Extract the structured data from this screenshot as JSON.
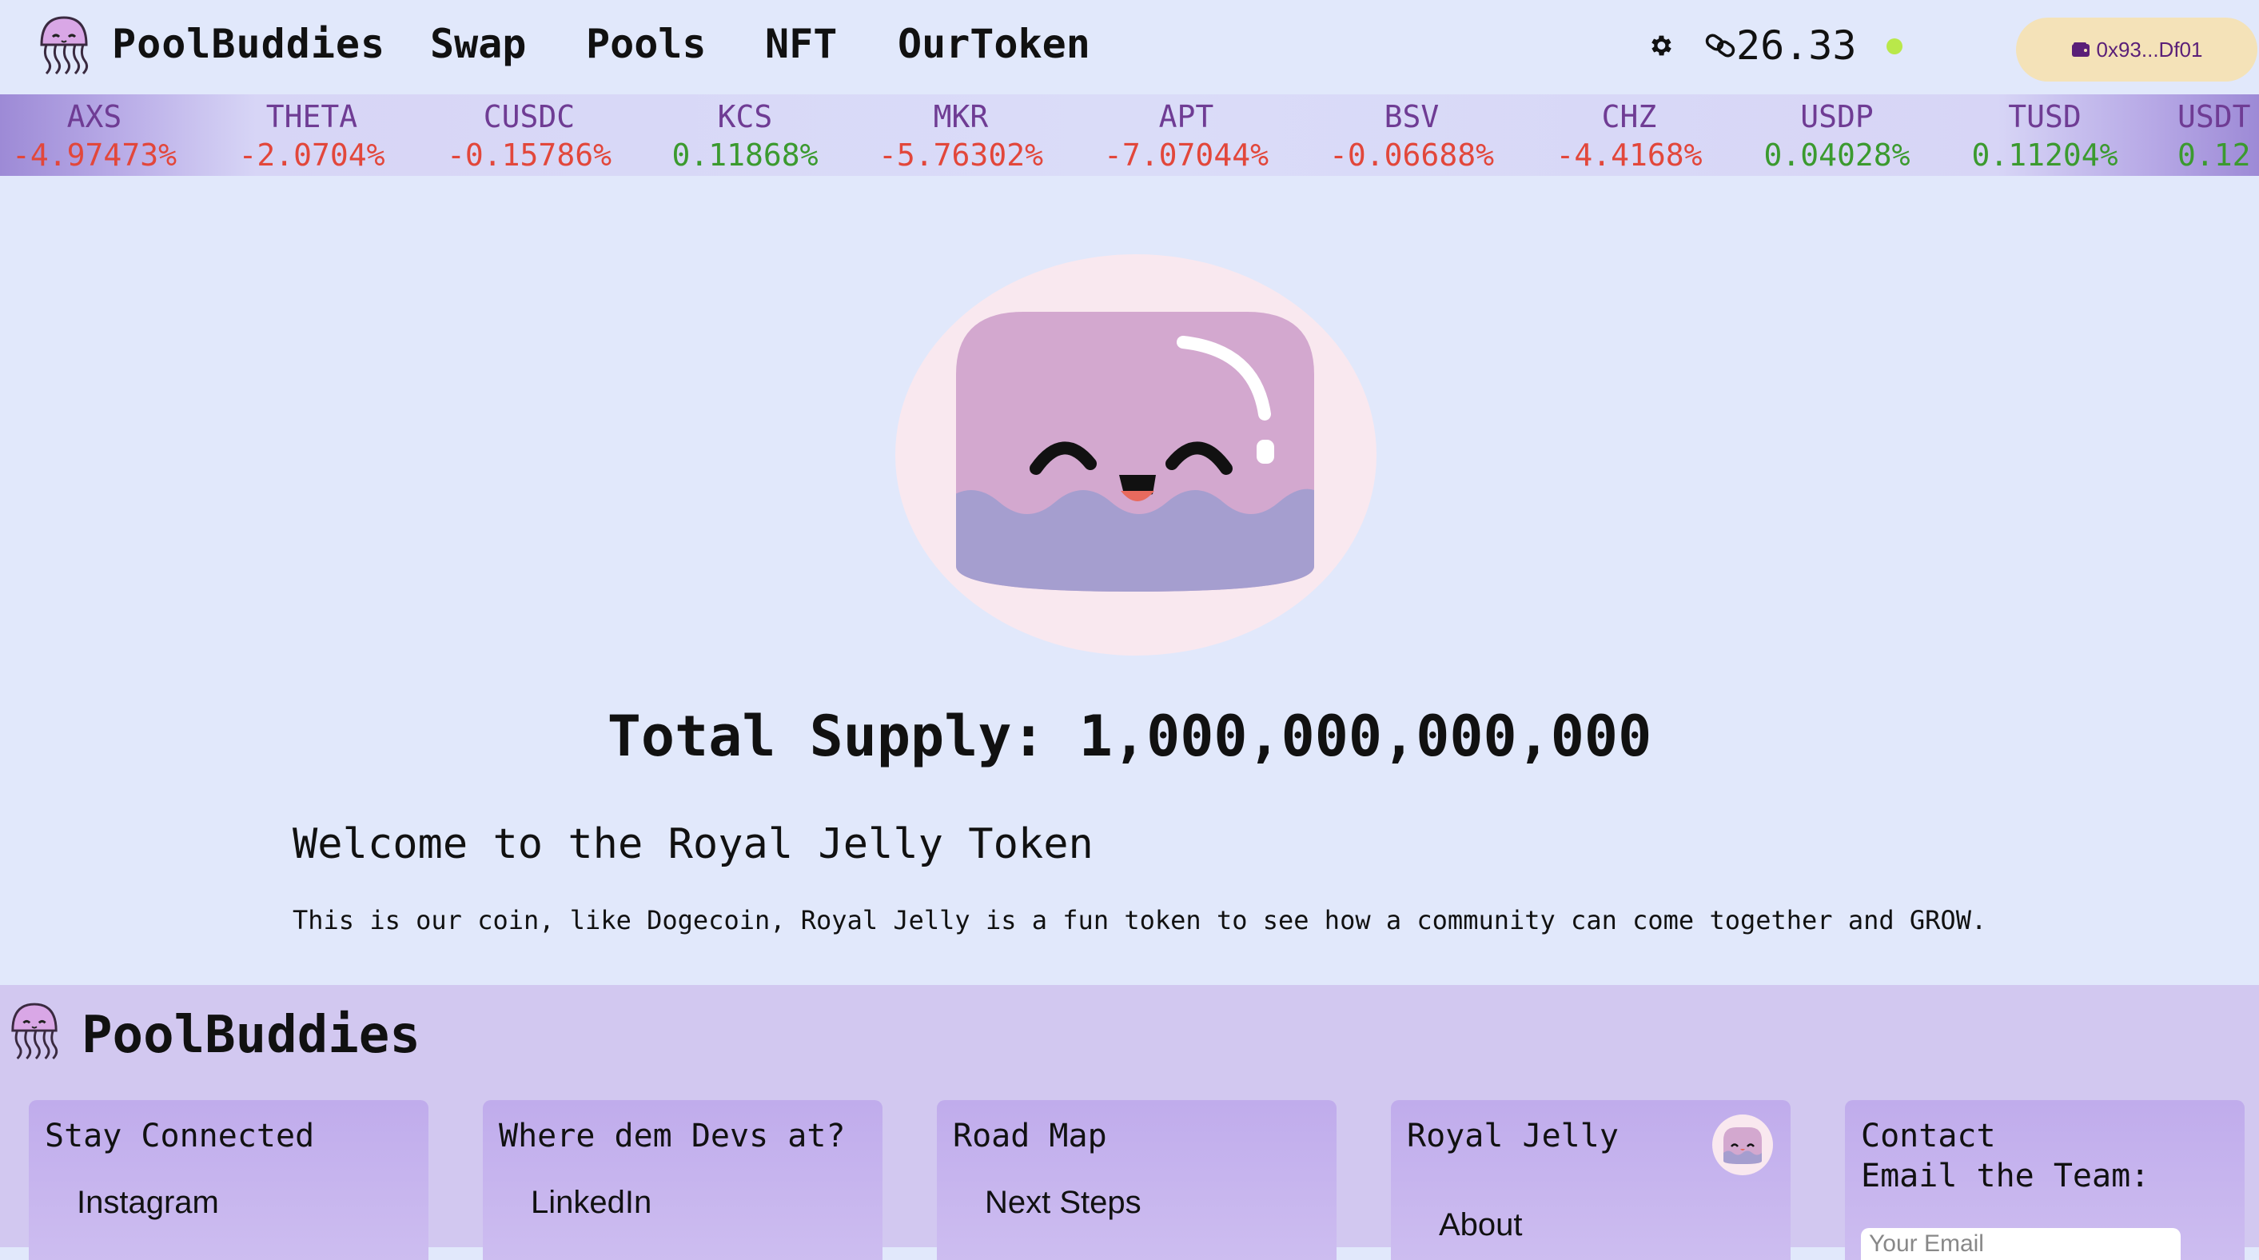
{
  "nav": {
    "brand": "PoolBuddies",
    "links": [
      "Swap",
      "Pools",
      "NFT",
      "OurToken"
    ],
    "price": "26.33",
    "wallet": "0x93...Df01"
  },
  "ticker": [
    {
      "symbol": "AXS",
      "change": "-4.97473%",
      "direction": "neg"
    },
    {
      "symbol": "THETA",
      "change": "-2.0704%",
      "direction": "neg"
    },
    {
      "symbol": "CUSDC",
      "change": "-0.15786%",
      "direction": "neg"
    },
    {
      "symbol": "KCS",
      "change": "0.11868%",
      "direction": "pos"
    },
    {
      "symbol": "MKR",
      "change": "-5.76302%",
      "direction": "neg"
    },
    {
      "symbol": "APT",
      "change": "-7.07044%",
      "direction": "neg"
    },
    {
      "symbol": "BSV",
      "change": "-0.06688%",
      "direction": "neg"
    },
    {
      "symbol": "CHZ",
      "change": "-4.4168%",
      "direction": "neg"
    },
    {
      "symbol": "USDP",
      "change": "0.04028%",
      "direction": "pos"
    },
    {
      "symbol": "TUSD",
      "change": "0.11204%",
      "direction": "pos"
    },
    {
      "symbol": "USDT",
      "change": "0.12",
      "direction": "pos"
    }
  ],
  "hero": {
    "supply": "Total Supply: 1,000,000,000,000",
    "welcome": "Welcome to the Royal Jelly Token",
    "description": "This is our coin, like Dogecoin, Royal Jelly is a fun token to see how a community can come together and GROW."
  },
  "footer": {
    "brand": "PoolBuddies",
    "cards": [
      {
        "title": "Stay Connected",
        "link": "Instagram"
      },
      {
        "title": "Where dem Devs at?",
        "link": "LinkedIn"
      },
      {
        "title": "Road Map",
        "link": "Next Steps"
      },
      {
        "title": "Royal Jelly",
        "link": "About"
      },
      {
        "title": "Contact\nEmail the Team:",
        "placeholder": "Your Email"
      }
    ]
  },
  "colors": {
    "background": "#e1e8fb",
    "negative": "#e2473b",
    "positive": "#3b9a2f",
    "ticker_symbol": "#6f3c94",
    "wallet_bg": "#f4e2b8",
    "footer_bg": "#d2c8f0"
  },
  "icons": [
    "jellyfish-logo-icon",
    "gear-icon",
    "chainlink-icon",
    "wallet-icon",
    "status-dot-icon"
  ]
}
